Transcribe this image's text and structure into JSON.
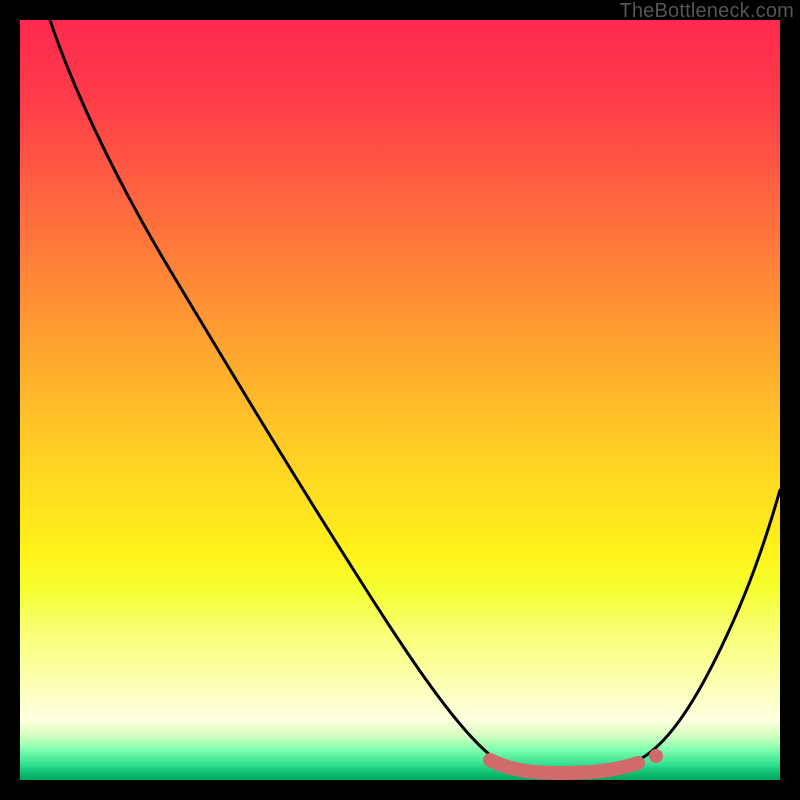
{
  "watermark": "TheBottleneck.com",
  "chart_data": {
    "type": "line",
    "title": "",
    "xlabel": "",
    "ylabel": "",
    "xlim": [
      0,
      100
    ],
    "ylim": [
      0,
      100
    ],
    "series": [
      {
        "name": "bottleneck-curve",
        "x": [
          4,
          10,
          20,
          30,
          40,
          50,
          57,
          62,
          67,
          72,
          78,
          82,
          85,
          90,
          95,
          100
        ],
        "y": [
          100,
          90,
          74,
          57,
          41,
          25,
          14,
          6,
          2,
          1,
          1,
          2,
          4,
          10,
          22,
          40
        ],
        "color": "#000000"
      },
      {
        "name": "marker-band",
        "x": [
          62,
          67,
          72,
          78,
          82
        ],
        "y": [
          1.2,
          0.8,
          0.7,
          1.0,
          2.0
        ],
        "color": "#d16a6a"
      }
    ],
    "annotations": []
  }
}
